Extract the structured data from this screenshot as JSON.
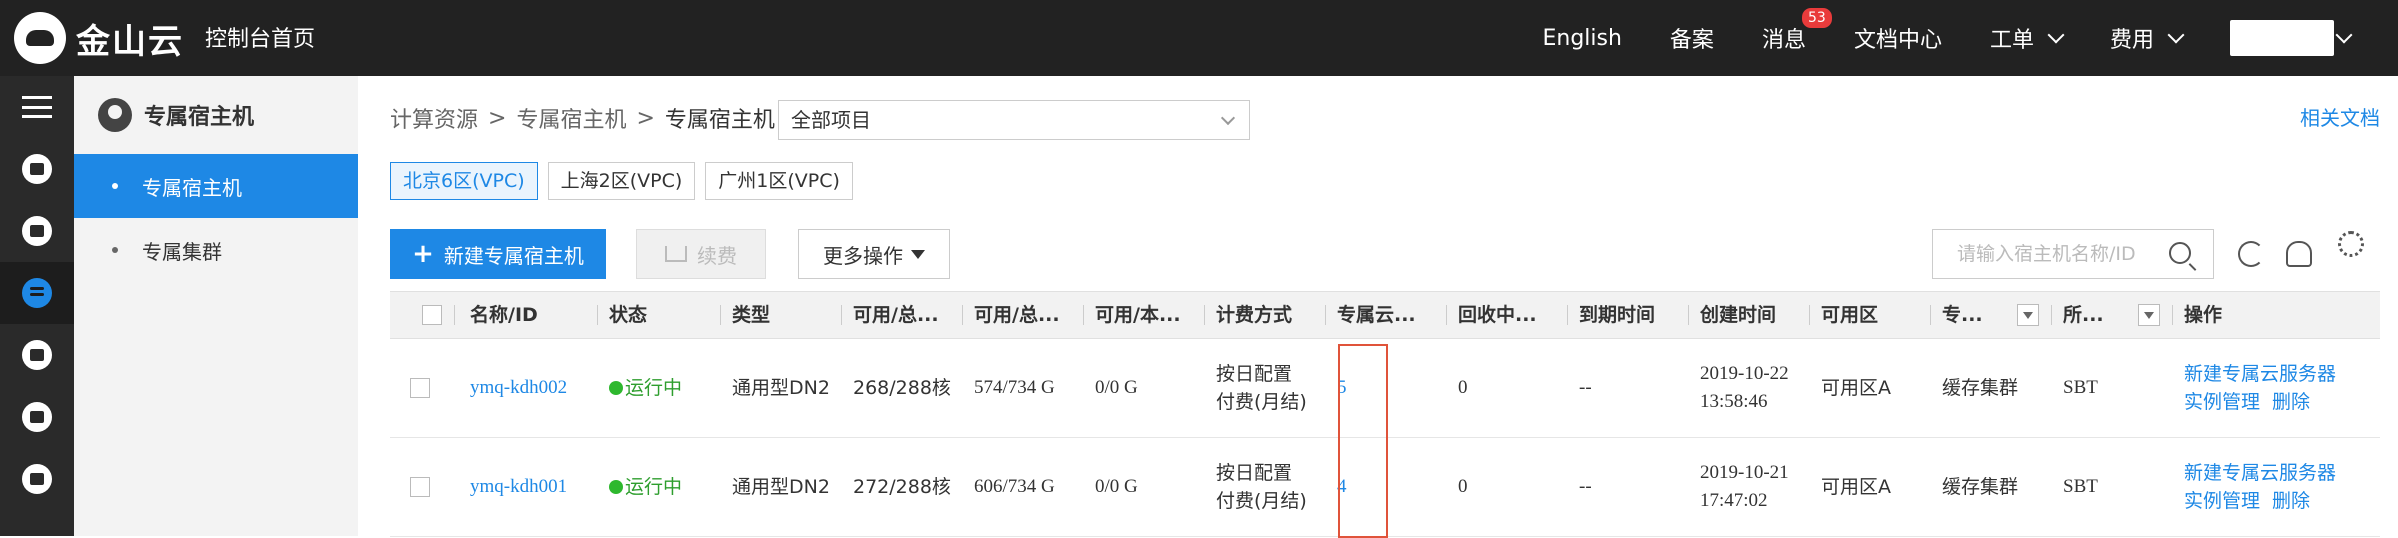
{
  "topbar": {
    "logo_text": "金山云",
    "console_home": "控制台首页",
    "nav": {
      "english": "English",
      "beian": "备案",
      "messages": "消息",
      "messages_badge": "53",
      "docs": "文档中心",
      "tickets": "工单",
      "billing": "费用"
    }
  },
  "submenu": {
    "title": "专属宿主机",
    "items": [
      {
        "label": "专属宿主机"
      },
      {
        "label": "专属集群"
      }
    ]
  },
  "breadcrumb": {
    "level1": "计算资源",
    "level2": "专属宿主机",
    "current": "专属宿主机",
    "sep": ">"
  },
  "project_select": {
    "value": "全部项目"
  },
  "doc_link": "相关文档",
  "regions": [
    "北京6区(VPC)",
    "上海2区(VPC)",
    "广州1区(VPC)"
  ],
  "toolbar": {
    "create": "新建专属宿主机",
    "renew": "续费",
    "more": "更多操作",
    "search_placeholder": "请输入宿主机名称/ID"
  },
  "table": {
    "headers": [
      "名称/ID",
      "状态",
      "类型",
      "可用/总...",
      "可用/总...",
      "可用/本...",
      "计费方式",
      "专属云...",
      "回收中...",
      "到期时间",
      "创建时间",
      "可用区",
      "专...",
      "所...",
      "操作"
    ],
    "rows": [
      {
        "name": "ymq-kdh002",
        "status": "运行中",
        "type": "通用型DN2",
        "cpu": "268/288核",
        "mem": "574/734 G",
        "disk": "0/0 G",
        "billing_1": "按日配置",
        "billing_2": "付费(月结)",
        "servers": "5",
        "recycling": "0",
        "expire": "--",
        "created_date": "2019-10-22",
        "created_time": "13:58:46",
        "zone": "可用区A",
        "cluster": "缓存集群",
        "project": "SBT",
        "op_create": "新建专属云服务器",
        "op_manage": "实例管理",
        "op_delete": "删除"
      },
      {
        "name": "ymq-kdh001",
        "status": "运行中",
        "type": "通用型DN2",
        "cpu": "272/288核",
        "mem": "606/734 G",
        "disk": "0/0 G",
        "billing_1": "按日配置",
        "billing_2": "付费(月结)",
        "servers": "4",
        "recycling": "0",
        "expire": "--",
        "created_date": "2019-10-21",
        "created_time": "17:47:02",
        "zone": "可用区A",
        "cluster": "缓存集群",
        "project": "SBT",
        "op_create": "新建专属云服务器",
        "op_manage": "实例管理",
        "op_delete": "删除"
      }
    ]
  },
  "colors": {
    "accent": "#1e88e5",
    "topbar_bg": "#222222",
    "running": "#2e9e2e",
    "badge": "#e93b3b",
    "highlight_box": "#e0533a"
  }
}
